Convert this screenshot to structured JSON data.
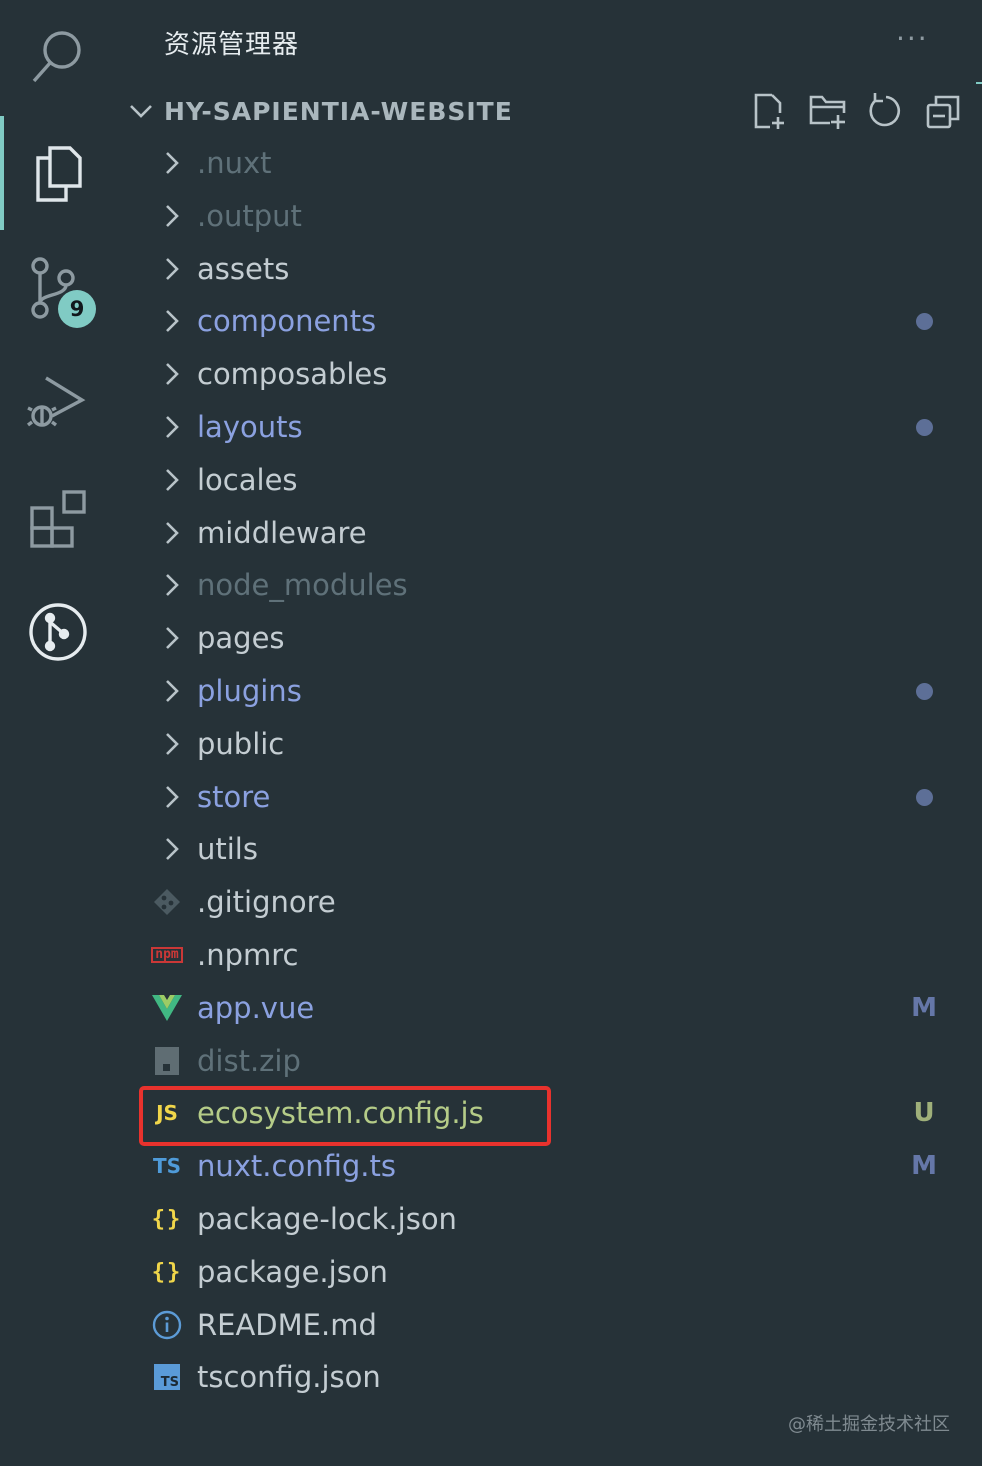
{
  "activity_bar": {
    "items": [
      {
        "name": "search",
        "icon": "search-icon"
      },
      {
        "name": "explorer",
        "icon": "files-icon",
        "active": true
      },
      {
        "name": "source-control",
        "icon": "source-control-icon",
        "badge": "9"
      },
      {
        "name": "run-debug",
        "icon": "run-debug-icon"
      },
      {
        "name": "extensions",
        "icon": "extensions-icon"
      },
      {
        "name": "git-graph",
        "icon": "git-graph-icon"
      }
    ],
    "accent_color": "#80cbc4"
  },
  "explorer": {
    "title": "资源管理器",
    "more_label": "···",
    "root": {
      "label": "HY-SAPIENTIA-WEBSITE",
      "actions": [
        "new-file-icon",
        "new-folder-icon",
        "refresh-icon",
        "collapse-all-icon"
      ]
    },
    "items": [
      {
        "label": ".nuxt",
        "kind": "folder",
        "state": "ignored",
        "deco": ""
      },
      {
        "label": ".output",
        "kind": "folder",
        "state": "ignored",
        "deco": ""
      },
      {
        "label": "assets",
        "kind": "folder",
        "state": "normal",
        "deco": ""
      },
      {
        "label": "components",
        "kind": "folder",
        "state": "modified",
        "deco": "dot"
      },
      {
        "label": "composables",
        "kind": "folder",
        "state": "normal",
        "deco": ""
      },
      {
        "label": "layouts",
        "kind": "folder",
        "state": "modified",
        "deco": "dot"
      },
      {
        "label": "locales",
        "kind": "folder",
        "state": "normal",
        "deco": ""
      },
      {
        "label": "middleware",
        "kind": "folder",
        "state": "normal",
        "deco": ""
      },
      {
        "label": "node_modules",
        "kind": "folder",
        "state": "ignored",
        "deco": ""
      },
      {
        "label": "pages",
        "kind": "folder",
        "state": "normal",
        "deco": ""
      },
      {
        "label": "plugins",
        "kind": "folder",
        "state": "modified",
        "deco": "dot"
      },
      {
        "label": "public",
        "kind": "folder",
        "state": "normal",
        "deco": ""
      },
      {
        "label": "store",
        "kind": "folder",
        "state": "modified",
        "deco": "dot"
      },
      {
        "label": "utils",
        "kind": "folder",
        "state": "normal",
        "deco": ""
      },
      {
        "label": ".gitignore",
        "kind": "file",
        "icon": "git-icon",
        "state": "normal",
        "deco": ""
      },
      {
        "label": ".npmrc",
        "kind": "file",
        "icon": "npm-icon",
        "icon_text": "npm",
        "state": "normal",
        "deco": ""
      },
      {
        "label": "app.vue",
        "kind": "file",
        "icon": "vue-icon",
        "state": "modified",
        "deco": "M"
      },
      {
        "label": "dist.zip",
        "kind": "file",
        "icon": "zip-icon",
        "state": "ignored",
        "deco": ""
      },
      {
        "label": "ecosystem.config.js",
        "kind": "file",
        "icon": "js-icon",
        "icon_text": "JS",
        "state": "untracked",
        "deco": "U",
        "highlighted": true
      },
      {
        "label": "nuxt.config.ts",
        "kind": "file",
        "icon": "ts-icon",
        "icon_text": "TS",
        "state": "modified",
        "deco": "M"
      },
      {
        "label": "package-lock.json",
        "kind": "file",
        "icon": "json-icon",
        "icon_text": "{}",
        "state": "normal",
        "deco": ""
      },
      {
        "label": "package.json",
        "kind": "file",
        "icon": "json-icon",
        "icon_text": "{}",
        "state": "normal",
        "deco": ""
      },
      {
        "label": "README.md",
        "kind": "file",
        "icon": "info-icon",
        "state": "normal",
        "deco": ""
      },
      {
        "label": "tsconfig.json",
        "kind": "file",
        "icon": "tsconfig-icon",
        "icon_text": "TS",
        "state": "normal",
        "deco": ""
      }
    ]
  },
  "highlight_color": "#e8322d",
  "watermark": "@稀土掘金技术社区"
}
